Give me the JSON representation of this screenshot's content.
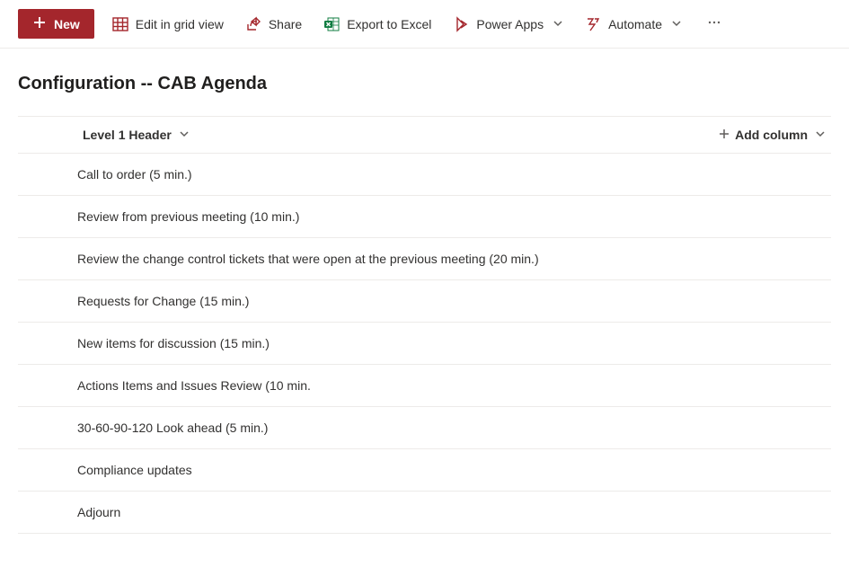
{
  "command_bar": {
    "new_label": "New",
    "edit_grid_label": "Edit in grid view",
    "share_label": "Share",
    "export_label": "Export to Excel",
    "power_apps_label": "Power Apps",
    "automate_label": "Automate"
  },
  "page": {
    "title": "Configuration -- CAB Agenda"
  },
  "columns": {
    "level1_header_label": "Level 1 Header",
    "add_column_label": "Add column"
  },
  "rows": [
    {
      "text": "Call to order (5 min.)"
    },
    {
      "text": "Review from previous meeting (10 min.)"
    },
    {
      "text": "Review the change control tickets that were open at the previous meeting (20 min.)"
    },
    {
      "text": "Requests for Change (15 min.)"
    },
    {
      "text": "New items for discussion (15 min.)"
    },
    {
      "text": "Actions Items and Issues Review (10 min."
    },
    {
      "text": "30-60-90-120 Look ahead (5 min.)"
    },
    {
      "text": "Compliance updates"
    },
    {
      "text": "Adjourn"
    }
  ]
}
